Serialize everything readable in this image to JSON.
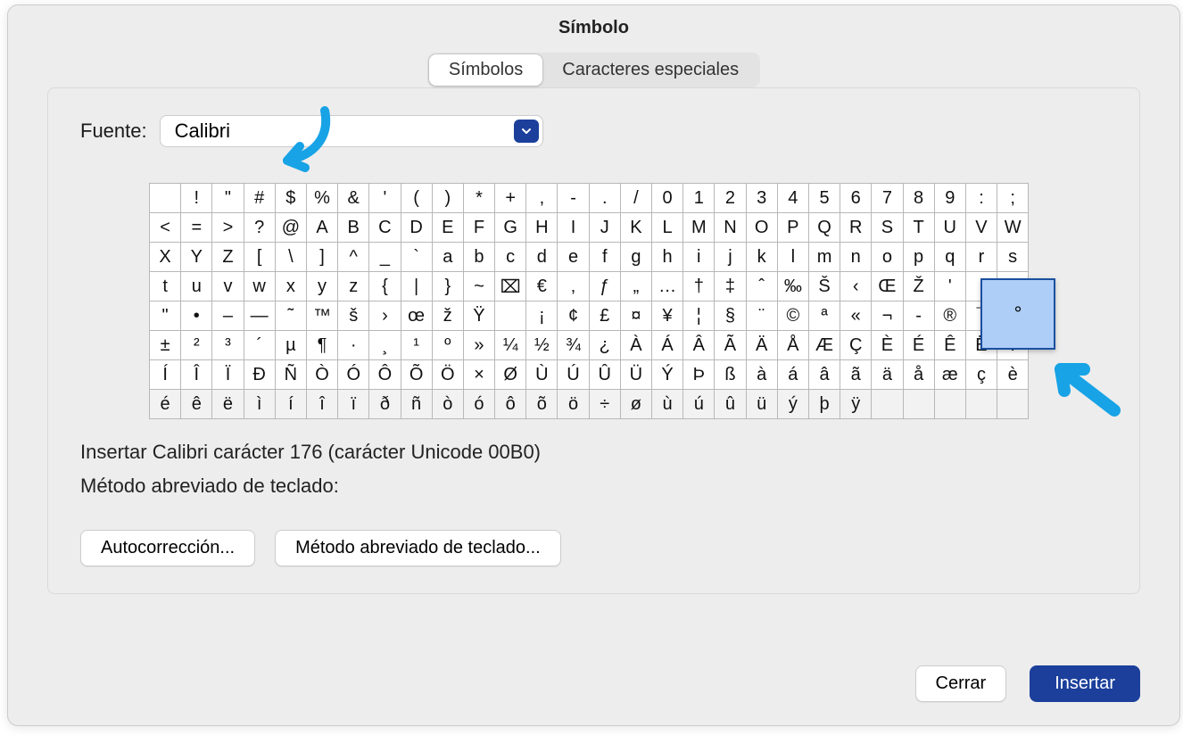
{
  "title": "Símbolo",
  "tabs": {
    "symbols": "Símbolos",
    "special": "Caracteres especiales"
  },
  "font": {
    "label": "Fuente:",
    "value": "Calibri"
  },
  "grid": {
    "rows": [
      [
        "",
        "!",
        "\"",
        "#",
        "$",
        "%",
        "&",
        "'",
        "(",
        ")",
        "*",
        "+",
        ",",
        "-",
        ".",
        "/",
        "0",
        "1",
        "2",
        "3",
        "4",
        "5",
        "6",
        "7",
        "8",
        "9",
        ":",
        ";"
      ],
      [
        "<",
        "=",
        ">",
        "?",
        "@",
        "A",
        "B",
        "C",
        "D",
        "E",
        "F",
        "G",
        "H",
        "I",
        "J",
        "K",
        "L",
        "M",
        "N",
        "O",
        "P",
        "Q",
        "R",
        "S",
        "T",
        "U",
        "V",
        "W"
      ],
      [
        "X",
        "Y",
        "Z",
        "[",
        "\\",
        "]",
        "^",
        "_",
        "`",
        "a",
        "b",
        "c",
        "d",
        "e",
        "f",
        "g",
        "h",
        "i",
        "j",
        "k",
        "l",
        "m",
        "n",
        "o",
        "p",
        "q",
        "r",
        "s"
      ],
      [
        "t",
        "u",
        "v",
        "w",
        "x",
        "y",
        "z",
        "{",
        "|",
        "}",
        "~",
        "⌧",
        "€",
        "‚",
        "ƒ",
        "„",
        "…",
        "†",
        "‡",
        "ˆ",
        "‰",
        "Š",
        "‹",
        "Œ",
        "Ž",
        "'",
        "'",
        "'"
      ],
      [
        "\"",
        "•",
        "–",
        "—",
        "˜",
        "™",
        "š",
        "›",
        "œ",
        "ž",
        "Ÿ",
        "",
        "¡",
        "¢",
        "£",
        "¤",
        "¥",
        "¦",
        "§",
        "¨",
        "©",
        "ª",
        "«",
        "¬",
        "-",
        "®",
        "¯",
        "°"
      ],
      [
        "±",
        "²",
        "³",
        "´",
        "µ",
        "¶",
        "·",
        "¸",
        "¹",
        "º",
        "»",
        "¼",
        "½",
        "¾",
        "¿",
        "À",
        "Á",
        "Â",
        "Ã",
        "Ä",
        "Å",
        "Æ",
        "Ç",
        "È",
        "É",
        "Ê",
        "Ë",
        "Ì"
      ],
      [
        "Í",
        "Î",
        "Ï",
        "Ð",
        "Ñ",
        "Ò",
        "Ó",
        "Ô",
        "Õ",
        "Ö",
        "×",
        "Ø",
        "Ù",
        "Ú",
        "Û",
        "Ü",
        "Ý",
        "Þ",
        "ß",
        "à",
        "á",
        "â",
        "ã",
        "ä",
        "å",
        "æ",
        "ç",
        "è"
      ],
      [
        "é",
        "ê",
        "ë",
        "ì",
        "í",
        "î",
        "ï",
        "ð",
        "ñ",
        "ò",
        "ó",
        "ô",
        "õ",
        "ö",
        "÷",
        "ø",
        "ù",
        "ú",
        "û",
        "ü",
        "ý",
        "þ",
        "ÿ",
        "",
        "",
        "",
        "",
        ""
      ]
    ]
  },
  "preview": "°",
  "info": {
    "line1": "Insertar Calibri carácter 176 (carácter Unicode 00B0)",
    "line2": "Método abreviado de teclado:"
  },
  "buttons": {
    "autocorrect": "Autocorrección...",
    "shortcut": "Método abreviado de teclado...",
    "close": "Cerrar",
    "insert": "Insertar"
  }
}
